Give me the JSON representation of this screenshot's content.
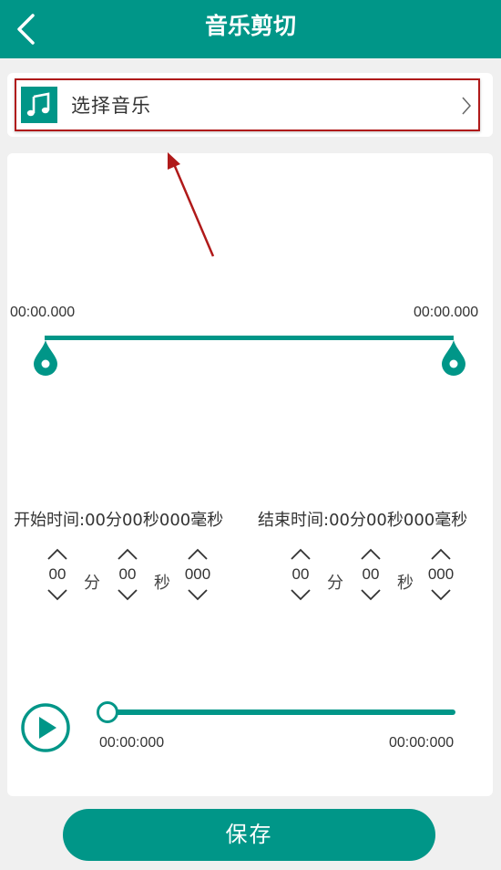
{
  "header": {
    "title": "音乐剪切",
    "back_icon": "chevron-left-icon"
  },
  "select_music": {
    "label": "选择音乐",
    "icon": "music-note-icon",
    "chevron_icon": "chevron-right-icon"
  },
  "waveform": {
    "start_time": "00:00.000",
    "end_time": "00:00.000"
  },
  "range": {
    "start_text": "开始时间:00分00秒000毫秒",
    "end_text": "结束时间:00分00秒000毫秒",
    "start": {
      "minutes": "00",
      "seconds": "00",
      "millis": "000"
    },
    "end": {
      "minutes": "00",
      "seconds": "00",
      "millis": "000"
    },
    "unit_minute": "分",
    "unit_second": "秒"
  },
  "player": {
    "current_time": "00:00:000",
    "total_time": "00:00:000",
    "progress": 0
  },
  "save_label": "保存",
  "colors": {
    "accent": "#009688",
    "highlight_border": "#b01a1a"
  }
}
